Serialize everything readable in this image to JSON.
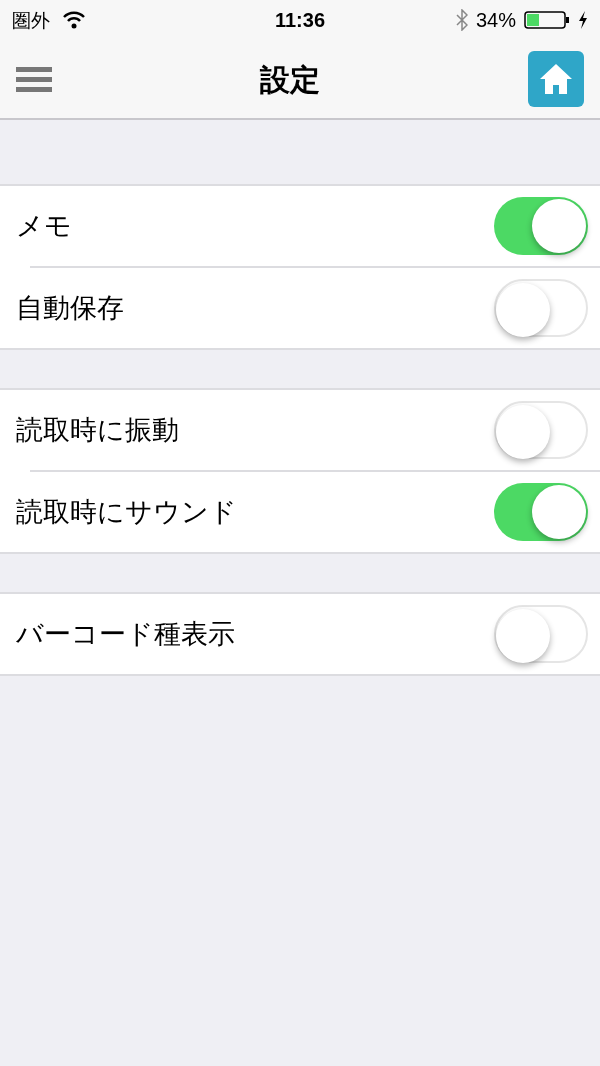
{
  "status_bar": {
    "carrier": "圏外",
    "time": "11:36",
    "battery": "34%"
  },
  "nav_bar": {
    "title": "設定"
  },
  "sections": [
    {
      "rows": [
        {
          "label": "メモ",
          "on": true
        },
        {
          "label": "自動保存",
          "on": false
        }
      ]
    },
    {
      "rows": [
        {
          "label": "読取時に振動",
          "on": false
        },
        {
          "label": "読取時にサウンド",
          "on": true
        }
      ]
    },
    {
      "rows": [
        {
          "label": "バーコード種表示",
          "on": false
        }
      ]
    }
  ]
}
